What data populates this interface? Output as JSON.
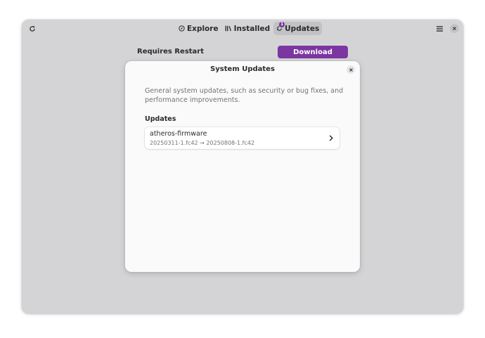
{
  "window": {
    "tabs": [
      {
        "label": "Explore",
        "icon": "compass-icon"
      },
      {
        "label": "Installed",
        "icon": "library-icon"
      },
      {
        "label": "Updates",
        "icon": "updates-icon",
        "badge": "1",
        "active": true
      }
    ]
  },
  "background": {
    "requires_restart_label": "Requires Restart",
    "download_label": "Download"
  },
  "dialog": {
    "title": "System Updates",
    "description": "General system updates, such as security or bug fixes, and performance improvements.",
    "section_title": "Updates",
    "updates": [
      {
        "name": "atheros-firmware",
        "version": "20250311-1.fc42 → 20250808-1.fc42"
      }
    ]
  },
  "colors": {
    "accent": "#7b36a1",
    "window_bg": "#d4d4d6",
    "dialog_bg": "#fafafa"
  }
}
